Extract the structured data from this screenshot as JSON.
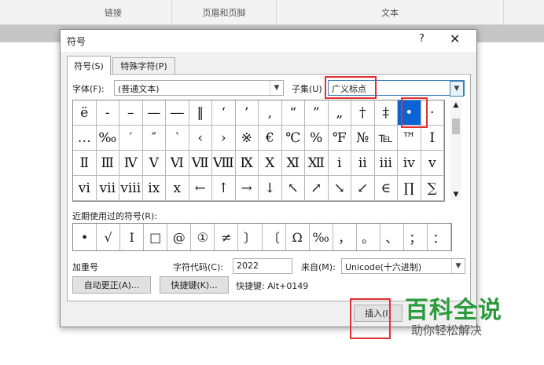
{
  "ribbon": {
    "groups": [
      "链接",
      "页眉和页脚",
      "文本"
    ]
  },
  "dialog": {
    "title": "符号",
    "help": "?",
    "close": "✕",
    "tabs": [
      "符号(S)",
      "特殊字符(P)"
    ],
    "font_label": "字体(F):",
    "font_value": "(普通文本)",
    "subset_label": "子集(U)",
    "subset_value": "广义标点",
    "symbols": [
      [
        "ë",
        "-",
        "–",
        "—",
        "―",
        "‖",
        "‘",
        "’",
        "‚",
        "“",
        "”",
        "„",
        "†",
        "‡",
        "•",
        "·"
      ],
      [
        "…",
        "‰",
        "′",
        "″",
        "‵",
        "‹",
        "›",
        "※",
        "€",
        "℃",
        "%",
        "℉",
        "№",
        "℡",
        "™",
        "Ⅰ"
      ],
      [
        "Ⅱ",
        "Ⅲ",
        "Ⅳ",
        "Ⅴ",
        "Ⅵ",
        "Ⅶ",
        "Ⅷ",
        "Ⅸ",
        "Ⅹ",
        "Ⅺ",
        "Ⅻ",
        "ⅰ",
        "ⅱ",
        "ⅲ",
        "ⅳ",
        "ⅴ"
      ],
      [
        "ⅵ",
        "ⅶ",
        "ⅷ",
        "ⅸ",
        "ⅹ",
        "←",
        "↑",
        "→",
        "↓",
        "↖",
        "↗",
        "↘",
        "↙",
        "∈",
        "∏",
        "∑"
      ]
    ],
    "recent_label": "近期使用过的符号(R):",
    "recent": [
      "•",
      "√",
      "I",
      "□",
      "@",
      "①",
      "≠",
      "〕",
      "〔",
      "Ω",
      "‰",
      "，",
      "。",
      "、",
      "；",
      "："
    ],
    "char_name": "加重号",
    "code_label": "字符代码(C):",
    "code_value": "2022",
    "from_label": "来自(M):",
    "from_value": "Unicode(十六进制)",
    "autocorrect_button": "自动更正(A)...",
    "shortcut_button": "快捷键(K)...",
    "shortcut_text": "快捷键: Alt+0149",
    "insert_button": "插入(I)"
  },
  "watermark": {
    "title": "百科全说",
    "subtitle": "助你轻松解决"
  },
  "colors": {
    "highlight": "#e03030",
    "selection": "#0a64d6",
    "watermark": "#2b9b3e"
  }
}
